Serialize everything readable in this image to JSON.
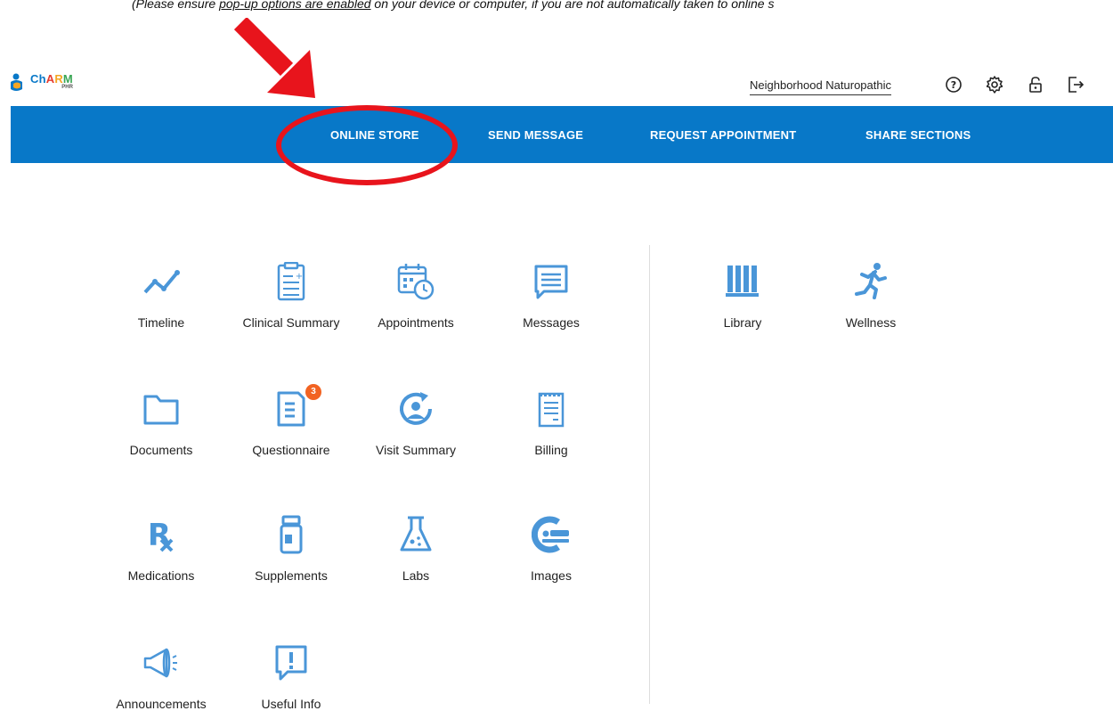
{
  "notice": {
    "prefix": "(Please ensure ",
    "link": "pop-up options are enabled",
    "suffix": " on your device or computer, if you are not automatically taken to online s"
  },
  "header": {
    "logo_text": "ChARM",
    "logo_sub": "PHR",
    "practice_name": "Neighborhood Naturopathic",
    "icons": [
      "help-icon",
      "gear-icon",
      "lock-icon",
      "logout-icon"
    ]
  },
  "nav": {
    "items": [
      {
        "label": "ONLINE STORE"
      },
      {
        "label": "SEND MESSAGE"
      },
      {
        "label": "REQUEST APPOINTMENT"
      },
      {
        "label": "SHARE SECTIONS"
      }
    ]
  },
  "tiles": {
    "timeline": {
      "label": "Timeline",
      "icon": "trend-line-icon"
    },
    "clinical_summary": {
      "label": "Clinical Summary",
      "icon": "clipboard-icon"
    },
    "appointments": {
      "label": "Appointments",
      "icon": "calendar-clock-icon"
    },
    "messages": {
      "label": "Messages",
      "icon": "message-icon"
    },
    "documents": {
      "label": "Documents",
      "icon": "folder-icon"
    },
    "questionnaire": {
      "label": "Questionnaire",
      "icon": "questionnaire-icon",
      "badge": "3"
    },
    "visit_summary": {
      "label": "Visit Summary",
      "icon": "visit-icon"
    },
    "billing": {
      "label": "Billing",
      "icon": "notepad-icon"
    },
    "medications": {
      "label": "Medications",
      "icon": "rx-icon"
    },
    "supplements": {
      "label": "Supplements",
      "icon": "bottle-icon"
    },
    "labs": {
      "label": "Labs",
      "icon": "flask-icon"
    },
    "images": {
      "label": "Images",
      "icon": "scanner-icon"
    },
    "announcements": {
      "label": "Announcements",
      "icon": "megaphone-icon"
    },
    "useful_info": {
      "label": "Useful Info",
      "icon": "info-bubble-icon"
    },
    "library": {
      "label": "Library",
      "icon": "books-icon"
    },
    "wellness": {
      "label": "Wellness",
      "icon": "runner-icon"
    }
  },
  "colors": {
    "nav_bg": "#0878c8",
    "icon_blue": "#4a96d8",
    "annotation_red": "#e8141c",
    "badge_orange": "#f26322"
  }
}
